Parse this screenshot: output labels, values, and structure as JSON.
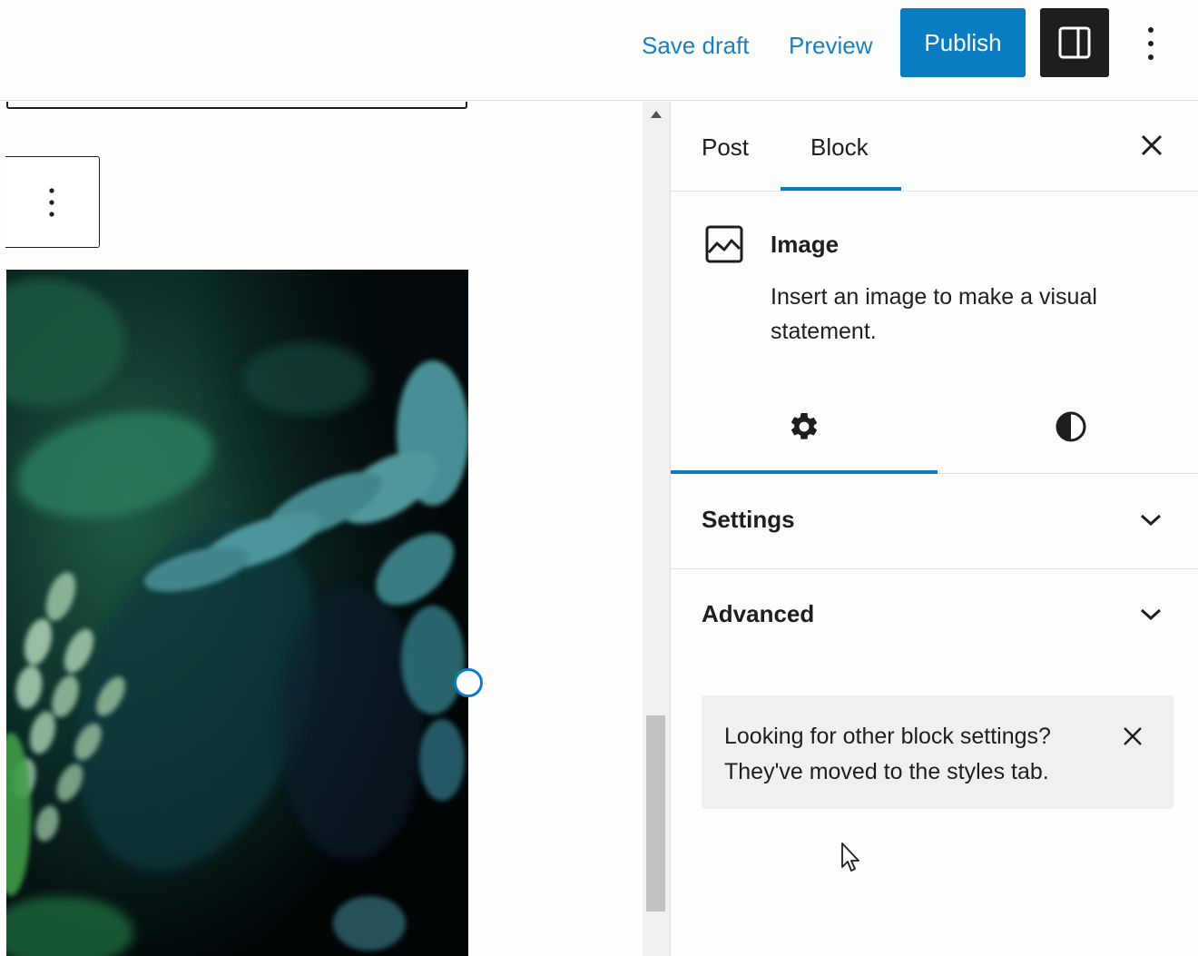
{
  "toolbar": {
    "save_draft_label": "Save draft",
    "preview_label": "Preview",
    "publish_label": "Publish",
    "icons": {
      "settings_toggle": "sidebar-panel-icon",
      "more": "vertical-ellipsis-icon"
    }
  },
  "sidebar": {
    "tabs": [
      {
        "label": "Post",
        "active": false
      },
      {
        "label": "Block",
        "active": true
      }
    ],
    "block_card": {
      "title": "Image",
      "description": "Insert an image to make a visual statement.",
      "icon": "image-icon"
    },
    "subtabs": [
      {
        "icon": "gear-icon",
        "active": true
      },
      {
        "icon": "half-circle-contrast-icon",
        "active": false
      }
    ],
    "panels": [
      {
        "label": "Settings",
        "expanded": false
      },
      {
        "label": "Advanced",
        "expanded": false
      }
    ],
    "notice": {
      "text": "Looking for other block settings? They've moved to the styles tab."
    }
  },
  "colors": {
    "accent": "#0a7cc1",
    "link": "#1b7fc0",
    "dark": "#1e1e1e",
    "notice_bg": "#f0f0f0"
  }
}
